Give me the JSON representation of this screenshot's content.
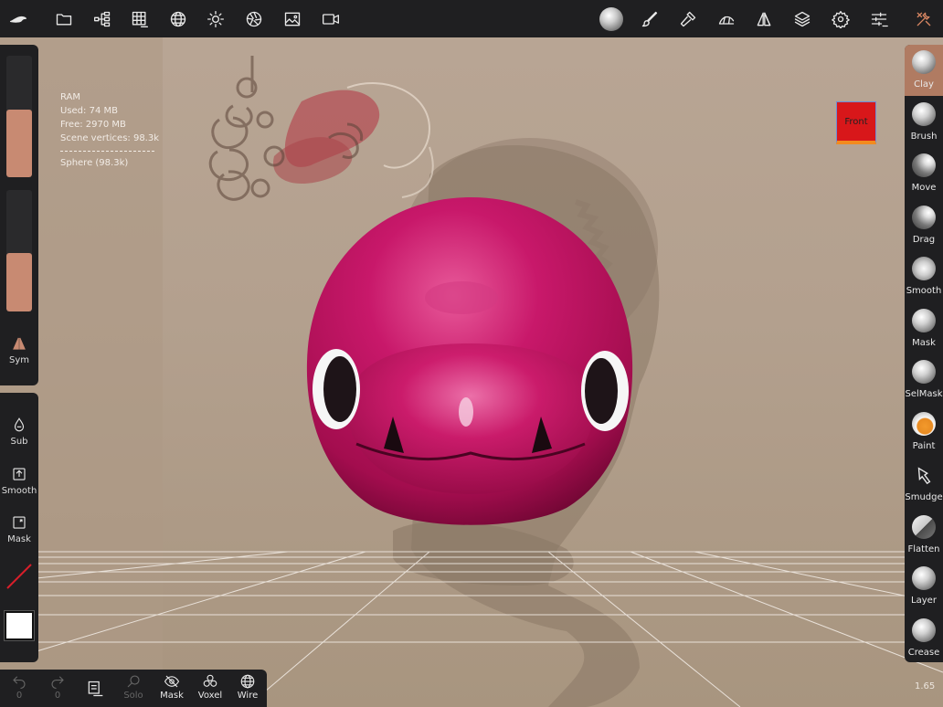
{
  "stats": {
    "title": "RAM",
    "used": "Used: 74 MB",
    "free": "Free: 2970 MB",
    "vertices": "Scene vertices: 98.3k",
    "object": "Sphere (98.3k)"
  },
  "gizmo": {
    "label": "Front"
  },
  "left_sliders": {
    "radius_level": 0.56,
    "intensity_level": 0.48
  },
  "left_tools": {
    "sym": "Sym",
    "sub": "Sub",
    "smooth": "Smooth",
    "mask": "Mask"
  },
  "bottom": {
    "undo_count": "0",
    "redo_count": "0",
    "solo": "Solo",
    "mask": "Mask",
    "voxel": "Voxel",
    "wire": "Wire"
  },
  "brushes": [
    {
      "label": "Clay"
    },
    {
      "label": "Brush"
    },
    {
      "label": "Move"
    },
    {
      "label": "Drag"
    },
    {
      "label": "Smooth"
    },
    {
      "label": "Mask"
    },
    {
      "label": "SelMask"
    },
    {
      "label": "Paint"
    },
    {
      "label": "Smudge"
    },
    {
      "label": "Flatten"
    },
    {
      "label": "Layer"
    },
    {
      "label": "Crease"
    }
  ],
  "version": "1.65",
  "colors": {
    "toolbar_bg": "#1f1f21",
    "accent": "#c88a72",
    "model": "#c0145a",
    "gizmo_front": "#d8171a"
  }
}
